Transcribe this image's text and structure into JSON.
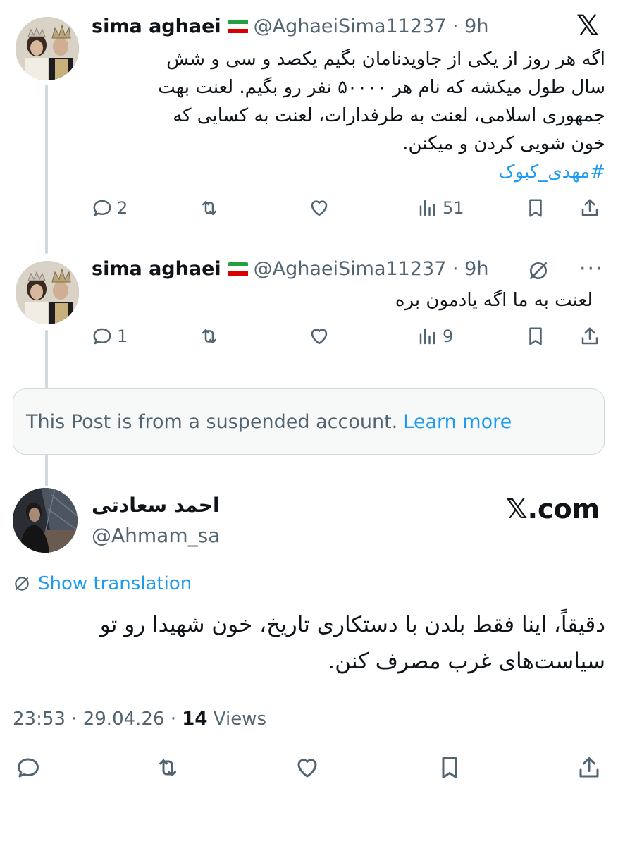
{
  "tweets": [
    {
      "name": "sima aghaei",
      "flag_colors": [
        "#239f40",
        "#ffffff",
        "#da0000"
      ],
      "handle": "@AghaeiSima11237 · 9h",
      "text_lines": [
        "اگه هر روز از یکی از جاویدنامان بگیم یکصد و سی و شش",
        "سال طول میکشه که نام هر ۵۰۰۰۰ نفر رو بگیم. لعنت بهت",
        "جمهوری اسلامی، لعنت به طرفدارات، لعنت به کسایی که",
        "خون شویی کردن و میکنن."
      ],
      "hashtag": "#مهدی_کبوک",
      "replies": "2",
      "retweets": "",
      "likes": "",
      "views": "51"
    },
    {
      "name": "sima aghaei",
      "handle": "@AghaeiSima11237 · 9h",
      "text": "لعنت به ما اگه یادمون بره",
      "replies": "1",
      "views": "9",
      "more": "···"
    }
  ],
  "suspended": {
    "text": "This Post is from a suspended account.",
    "link": "Learn more"
  },
  "main_post": {
    "name": "احمد سعادتی",
    "handle": "@Ahmam_sa",
    "watermark": "𝕏.com",
    "show_translation": "Show translation",
    "text_lines": [
      "دقیقاً، اینا فقط بلدن با دستکاری تاریخ، خون شهیدا رو تو",
      "سیاست‌های غرب مصرف کنن."
    ],
    "timestamp": "23:53 · 29.04.26 · ",
    "views_count": "14",
    "views_label": " Views"
  },
  "icons": {
    "x_logo": "𝕏",
    "reply": "reply-icon",
    "retweet": "retweet-icon",
    "like": "heart-icon",
    "views": "views-icon",
    "bookmark": "bookmark-icon",
    "share": "share-icon"
  },
  "colors": {
    "accent": "#1d9bf0",
    "secondary_text": "#536471",
    "thread_line": "#cfd9de"
  }
}
